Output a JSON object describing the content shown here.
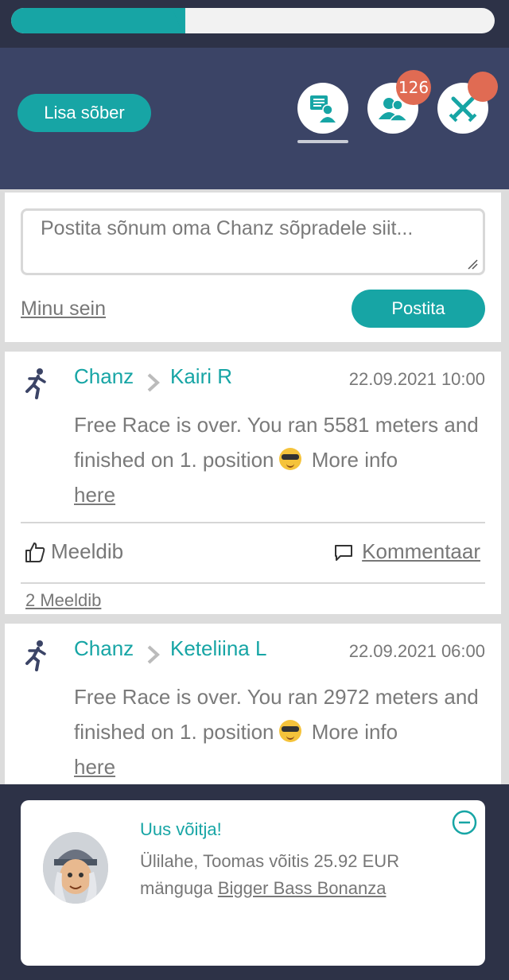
{
  "progress": {
    "fraction": 0.36
  },
  "header": {
    "add_friend_label": "Lisa sõber",
    "icons": [
      "feed-icon",
      "friends-icon",
      "battle-icon"
    ],
    "friends_badge": "126"
  },
  "composer": {
    "placeholder": "Postita sõnum oma Chanz sõpradele siit...",
    "my_wall_label": "Minu sein",
    "post_button_label": "Postita"
  },
  "feed": [
    {
      "from": "Chanz",
      "to": "Kairi R",
      "date": "22.09.2021 10:00",
      "text_before": "Free Race is over. You ran 5581 meters and finished on 1. position",
      "text_after": " More info ",
      "link": "here",
      "like_label": "Meeldib",
      "comment_label": "Kommentaar",
      "likes_count": "2 Meeldib"
    },
    {
      "from": "Chanz",
      "to": "Keteliina L",
      "date": "22.09.2021 06:00",
      "text_before": "Free Race is over. You ran 2972 meters and finished on 1. position",
      "text_after": " More info ",
      "link": "here"
    }
  ],
  "notification": {
    "title": "Uus võitja!",
    "text": "Ülilahe, Toomas võitis 25.92 EUR mänguga ",
    "game": "Bigger Bass Bonanza"
  },
  "colors": {
    "accent": "#17a5a5",
    "header": "#3b4466",
    "dark": "#2d3247",
    "badge": "#e06b53"
  }
}
